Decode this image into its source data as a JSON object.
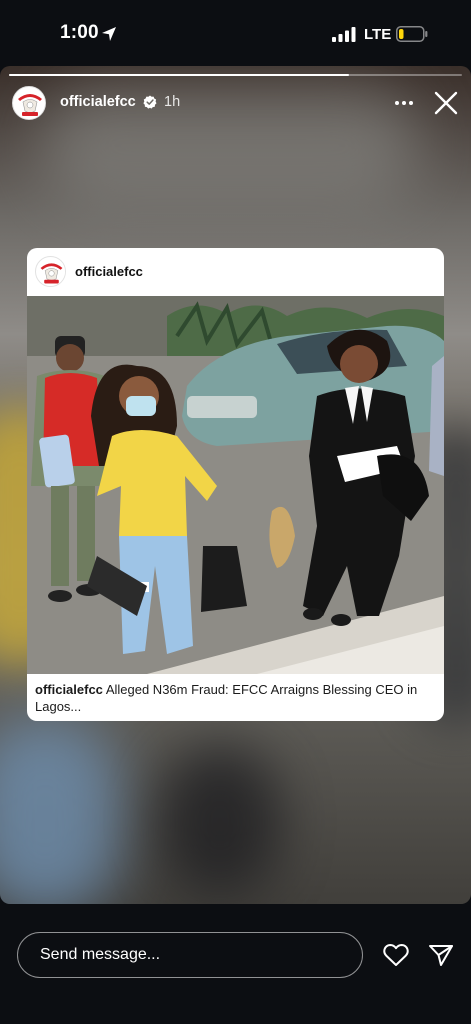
{
  "status_bar": {
    "time": "1:00",
    "network": "LTE",
    "icons": [
      "location-arrow-icon",
      "signal-icon",
      "battery-icon"
    ],
    "battery_level": 0.2,
    "battery_color": "#ffd60a"
  },
  "story": {
    "progress": 0.75,
    "username": "officialefcc",
    "verified": true,
    "time_ago": "1h",
    "icons": [
      "more-icon",
      "close-icon"
    ]
  },
  "post": {
    "username": "officialefcc",
    "caption_user": "officialefcc",
    "caption_text": "Alleged N36m Fraud: EFCC Arraigns Blessing CEO in Lagos..."
  },
  "composer": {
    "placeholder": "Send message...",
    "icons": [
      "heart-icon",
      "paper-plane-icon"
    ]
  },
  "colors": {
    "background": "#0c0e12",
    "efcc_red": "#d6232a",
    "verified_blue": "#ffffff"
  }
}
